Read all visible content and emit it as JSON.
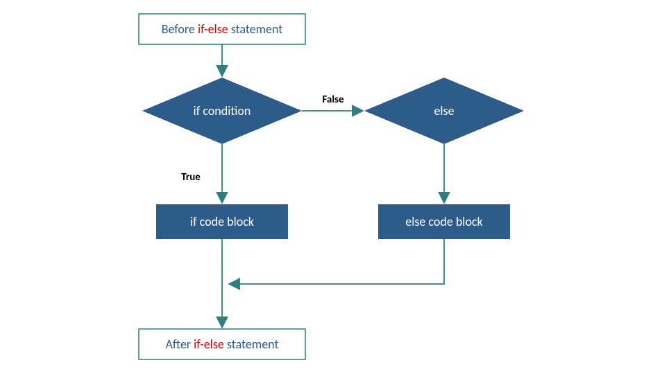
{
  "nodes": {
    "before": {
      "pre": "Before ",
      "kw": "if-else",
      "post": " statement"
    },
    "if_condition": "if condition",
    "else": "else",
    "if_block": "if code block",
    "else_block": "else code block",
    "after": {
      "pre": "After ",
      "kw": "if-else",
      "post": " statement"
    }
  },
  "edges": {
    "true_label": "True",
    "false_label": "False"
  },
  "colors": {
    "stroke": "#2f7f80",
    "fill": "#2e5c8a",
    "keyword": "#e20000"
  }
}
